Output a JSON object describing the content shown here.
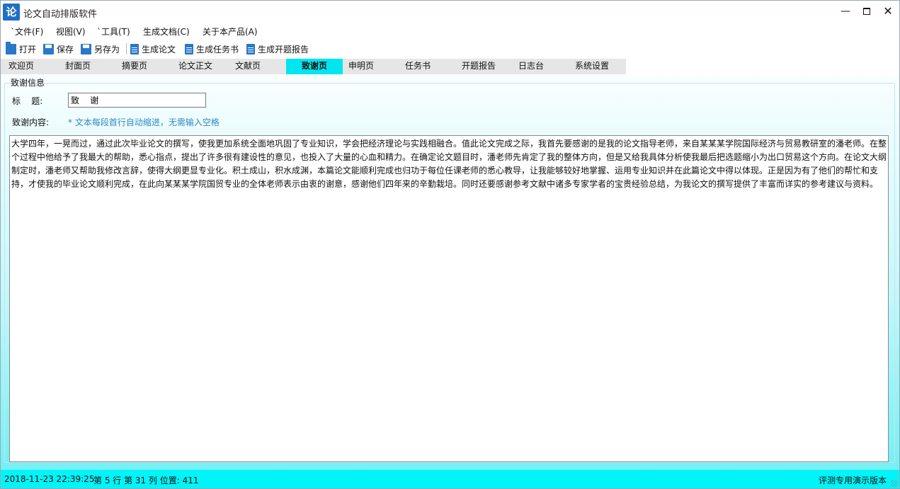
{
  "window": {
    "icon_char": "论",
    "title": "论文自动排版软件",
    "minimize": "—",
    "close": "✕"
  },
  "menu": {
    "file": "`文件(F)",
    "view": "视图(V)",
    "tools": "`工具(T)",
    "generate": "生成文档(C)",
    "about": "关于本产品(A)"
  },
  "toolbar": {
    "open": "打开",
    "save": "保存",
    "save_as": "另存为",
    "gen_paper": "生成论文",
    "gen_task": "生成任务书",
    "gen_proposal": "生成开题报告"
  },
  "tabs": [
    "欢迎页",
    "封面页",
    "摘要页",
    "论文正文",
    "文献页",
    "致谢页",
    "申明页",
    "任务书",
    "开题报告",
    "日志台",
    "系统设置"
  ],
  "active_tab": 5,
  "form": {
    "group_title": "致谢信息",
    "title_label": "标    题:",
    "title_value": "致    谢",
    "content_label": "致谢内容:",
    "hint": "* 文本每段首行自动缩进，无需输入空格",
    "content": "大学四年，一晃而过，通过此次毕业论文的撰写，使我更加系统全面地巩固了专业知识，学会把经济理论与实践相融合。值此论文完成之际，我首先要感谢的是我的论文指导老师，来自某某某学院国际经济与贸易教研室的潘老师。在整个过程中他给予了我最大的帮助，悉心指点，提出了许多很有建设性的意见，也投入了大量的心血和精力。在确定论文题目时，潘老师先肯定了我的整体方向，但是又给我具体分析使我最后把选题缩小为出口贸易这个方向。在论文大纲制定时，潘老师又帮助我修改言辞，使得大纲更显专业化。积土成山，积水成渊，本篇论文能顺利完成也归功于每位任课老师的悉心教导，让我能够较好地掌握、运用专业知识并在此篇论文中得以体现。正是因为有了他们的帮忙和支持，才使我的毕业论文顺利完成，在此向某某某学院国贸专业的全体老师表示由衷的谢意，感谢他们四年来的辛勤栽培。同时还要感谢参考文献中诸多专家学者的宝贵经验总结，为我论文的撰写提供了丰富而详实的参考建议与资料。"
  },
  "status": {
    "datetime": "2018-11-23 22:39:25",
    "position": "第 5 行 第 31 列 位置: 411",
    "edition": "评测专用演示版本"
  },
  "colors": {
    "accent": "#00e6f0",
    "status_bg": "#00f4f8",
    "hint": "#2f88c9",
    "icon_blue": "#2a78c8"
  }
}
